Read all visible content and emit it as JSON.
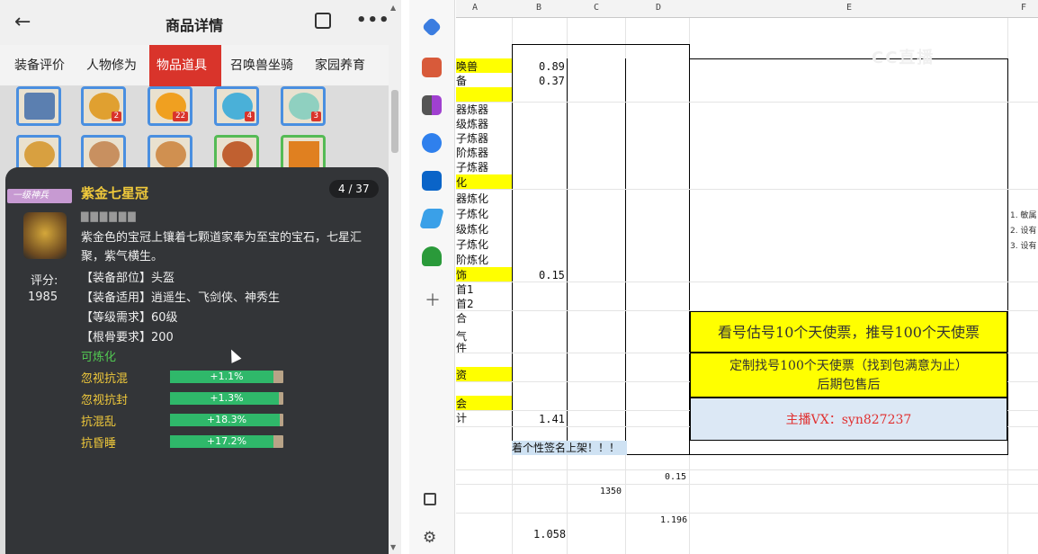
{
  "phone": {
    "title": "商品详情",
    "back_icon": "arrow-left-icon",
    "share_icon": "share-icon",
    "more_icon": "more-icon",
    "more_glyph": "•••",
    "tabs": [
      "装备评价",
      "人物修为",
      "物品道具",
      "召唤兽坐骑",
      "家园养育"
    ],
    "active_tab": 2,
    "item_counts": [
      "2",
      "22",
      "4",
      "3"
    ]
  },
  "popup": {
    "rank_label": "一级神兵",
    "item_name": "紫金七星冠",
    "page": "4 / 37",
    "stars": "▇▇▇▇▇▇",
    "description": "紫金色的宝冠上镶着七颗道家奉为至宝的宝石，七星汇聚，紫气横生。",
    "score_label": "评分:",
    "score_value": "1985",
    "attributes": [
      "【装备部位】头盔",
      "【装备适用】逍遥生、飞剑侠、神秀生",
      "【等级需求】60级",
      "【根骨要求】200"
    ],
    "refine_label": "可炼化",
    "bonuses": [
      {
        "name": "忽视抗混",
        "value": "+1.1%"
      },
      {
        "name": "忽视抗封",
        "value": "+1.3%"
      },
      {
        "name": "抗混乱",
        "value": "+18.3%"
      },
      {
        "name": "抗昏睡",
        "value": "+17.2%"
      }
    ]
  },
  "sheet": {
    "columns": [
      "A",
      "B",
      "C",
      "D",
      "E",
      "F"
    ],
    "row_labels": [
      "唤兽",
      "备",
      "",
      "器炼器",
      "级炼器",
      "子炼器",
      "阶炼器",
      "子炼器",
      "化",
      "器炼化",
      "子炼化",
      "级炼化",
      "子炼化",
      "阶炼化",
      "饰",
      "首1",
      "首2",
      "合",
      "气",
      "件",
      "",
      "资",
      "",
      "会",
      "计"
    ],
    "values": {
      "b_row1": "0.89",
      "b_row2": "0.37",
      "b_shi": "0.15",
      "b_ji": "1.41",
      "d_lower1": "0.15",
      "c_lower": "1350",
      "d_lower2": "1.196",
      "b_lower": "1.058"
    },
    "banner1": "看号估号10个天使票，推号100个天使票",
    "banner2_line1": "定制找号100个天使票（找到包满意为止）",
    "banner2_line2": "后期包售后",
    "banner3": "主播VX：syn827237",
    "signature_note": "着个性签名上架！！！",
    "notes": [
      "1. 敏属",
      "2. 设有",
      "3. 设有"
    ],
    "watermark": "CC直播"
  },
  "colors": {
    "accent": "#d9342b",
    "yellow": "#ffff00",
    "gold": "#f0c93b",
    "green": "#2fb86a"
  }
}
